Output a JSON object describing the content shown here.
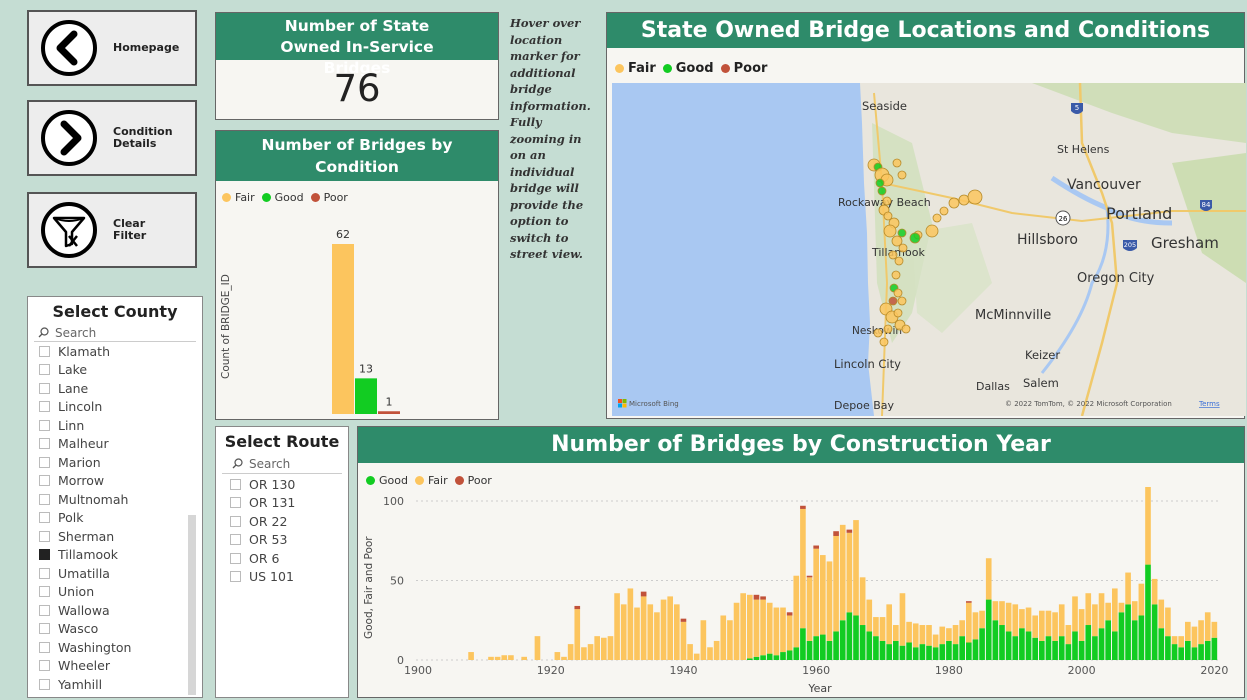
{
  "nav": {
    "home_label": "Homepage",
    "condition_label": "Condition\nDetails",
    "clear_label": "Clear\nFilter"
  },
  "kpi": {
    "title": "Number of State Owned In-Service Bridges",
    "value": "76"
  },
  "note": "Hover over location marker for additional bridge information. Fully zooming in on an individual bridge will provide the option to switch to street view.",
  "colors": {
    "fair": "#fcc55e",
    "good": "#12cc22",
    "poor": "#c1523a",
    "header": "#2e8b6a",
    "background": "#c5ddd3"
  },
  "condition_chart": {
    "title": "Number of Bridges by Condition",
    "legend": [
      "Fair",
      "Good",
      "Poor"
    ],
    "ylabel": "Count of BRIDGE_ID"
  },
  "county_slicer": {
    "title": "Select County",
    "search_placeholder": "Search",
    "items": [
      {
        "label": "Klamath",
        "checked": false
      },
      {
        "label": "Lake",
        "checked": false
      },
      {
        "label": "Lane",
        "checked": false
      },
      {
        "label": "Lincoln",
        "checked": false
      },
      {
        "label": "Linn",
        "checked": false
      },
      {
        "label": "Malheur",
        "checked": false
      },
      {
        "label": "Marion",
        "checked": false
      },
      {
        "label": "Morrow",
        "checked": false
      },
      {
        "label": "Multnomah",
        "checked": false
      },
      {
        "label": "Polk",
        "checked": false
      },
      {
        "label": "Sherman",
        "checked": false
      },
      {
        "label": "Tillamook",
        "checked": true
      },
      {
        "label": "Umatilla",
        "checked": false
      },
      {
        "label": "Union",
        "checked": false
      },
      {
        "label": "Wallowa",
        "checked": false
      },
      {
        "label": "Wasco",
        "checked": false
      },
      {
        "label": "Washington",
        "checked": false
      },
      {
        "label": "Wheeler",
        "checked": false
      },
      {
        "label": "Yamhill",
        "checked": false
      }
    ]
  },
  "route_slicer": {
    "title": "Select Route",
    "search_placeholder": "Search",
    "items": [
      "OR 130",
      "OR 131",
      "OR 22",
      "OR 53",
      "OR 6",
      "US 101"
    ]
  },
  "map": {
    "title": "State Owned Bridge Locations and Conditions",
    "legend": [
      "Fair",
      "Good",
      "Poor"
    ],
    "places": [
      "Seaside",
      "St Helens",
      "Vancouver",
      "Portland",
      "Rockaway Beach",
      "Hillsboro",
      "Gresham",
      "Tillamook",
      "Oregon City",
      "McMinnville",
      "Neskowin",
      "Lincoln City",
      "Keizer",
      "Salem",
      "Dallas",
      "Depoe Bay"
    ],
    "shields": [
      "5",
      "26",
      "84",
      "205"
    ],
    "bing": "Microsoft Bing",
    "copyright": "© 2022 TomTom, © 2022 Microsoft Corporation",
    "terms": "Terms"
  },
  "chart_data": [
    {
      "type": "bar",
      "title": "Number of Bridges by Condition",
      "categories": [
        "Fair",
        "Good",
        "Poor"
      ],
      "values": [
        62,
        13,
        1
      ],
      "ylabel": "Count of BRIDGE_ID",
      "ylim": [
        0,
        62
      ]
    },
    {
      "type": "bar",
      "title": "Number of Bridges by Construction Year",
      "xlabel": "Year",
      "ylabel": "Good, Fair and Poor",
      "legend": [
        "Good",
        "Fair",
        "Poor"
      ],
      "stacked": true,
      "xlim": [
        1900,
        2021
      ],
      "ylim": [
        0,
        100
      ],
      "yticks": [
        0,
        50,
        100
      ],
      "xticks": [
        1900,
        1920,
        1940,
        1960,
        1980,
        2000,
        2020
      ],
      "x": [
        1908,
        1911,
        1912,
        1913,
        1914,
        1916,
        1918,
        1921,
        1922,
        1923,
        1924,
        1925,
        1926,
        1927,
        1928,
        1929,
        1930,
        1931,
        1932,
        1933,
        1934,
        1935,
        1936,
        1937,
        1938,
        1939,
        1940,
        1941,
        1942,
        1943,
        1944,
        1945,
        1946,
        1947,
        1948,
        1949,
        1950,
        1951,
        1952,
        1953,
        1954,
        1955,
        1956,
        1957,
        1958,
        1959,
        1960,
        1961,
        1962,
        1963,
        1964,
        1965,
        1966,
        1967,
        1968,
        1969,
        1970,
        1971,
        1972,
        1973,
        1974,
        1975,
        1976,
        1977,
        1978,
        1979,
        1980,
        1981,
        1982,
        1983,
        1984,
        1985,
        1986,
        1987,
        1988,
        1989,
        1990,
        1991,
        1992,
        1993,
        1994,
        1995,
        1996,
        1997,
        1998,
        1999,
        2000,
        2001,
        2002,
        2003,
        2004,
        2005,
        2006,
        2007,
        2008,
        2009,
        2010,
        2011,
        2012,
        2013,
        2014,
        2015,
        2016,
        2017,
        2018,
        2019,
        2020
      ],
      "series": [
        {
          "name": "Good",
          "values": [
            0,
            0,
            0,
            0,
            0,
            0,
            0,
            0,
            0,
            0,
            0,
            0,
            0,
            0,
            0,
            0,
            0,
            0,
            0,
            0,
            0,
            0,
            0,
            0,
            0,
            0,
            0,
            0,
            0,
            0,
            0,
            0,
            0,
            0,
            0,
            0,
            1,
            2,
            3,
            4,
            3,
            5,
            6,
            8,
            20,
            12,
            15,
            16,
            12,
            18,
            25,
            30,
            28,
            22,
            18,
            15,
            12,
            10,
            12,
            9,
            11,
            8,
            10,
            9,
            8,
            10,
            12,
            10,
            15,
            11,
            13,
            20,
            38,
            25,
            22,
            18,
            15,
            20,
            18,
            14,
            12,
            15,
            12,
            15,
            10,
            18,
            12,
            22,
            15,
            20,
            25,
            18,
            30,
            35,
            25,
            28,
            60,
            35,
            20,
            15,
            10,
            8,
            12,
            8,
            10,
            12,
            14
          ],
          "poor_note": ""
        },
        {
          "name": "Fair",
          "values": [
            5,
            2,
            2,
            3,
            3,
            2,
            15,
            5,
            2,
            10,
            32,
            8,
            10,
            15,
            14,
            15,
            42,
            35,
            45,
            33,
            40,
            35,
            30,
            38,
            40,
            35,
            24,
            10,
            4,
            25,
            8,
            12,
            28,
            25,
            36,
            42,
            40,
            36,
            35,
            32,
            30,
            28,
            22,
            45,
            75,
            40,
            55,
            50,
            50,
            60,
            60,
            50,
            60,
            30,
            20,
            12,
            15,
            25,
            10,
            33,
            13,
            15,
            12,
            13,
            8,
            11,
            8,
            12,
            10,
            25,
            17,
            11,
            26,
            12,
            15,
            18,
            20,
            12,
            15,
            14,
            19,
            16,
            18,
            20,
            12,
            22,
            20,
            20,
            20,
            22,
            11,
            27,
            6,
            20,
            12,
            20,
            50,
            16,
            18,
            18,
            5,
            7,
            12,
            13,
            15,
            18,
            10
          ],
          "poor_note": ""
        },
        {
          "name": "Poor",
          "values": [
            0,
            0,
            0,
            0,
            0,
            0,
            0,
            0,
            0,
            0,
            2,
            0,
            0,
            0,
            0,
            0,
            0,
            0,
            0,
            0,
            3,
            0,
            0,
            0,
            0,
            0,
            2,
            0,
            0,
            0,
            0,
            0,
            0,
            0,
            0,
            0,
            0,
            3,
            2,
            0,
            0,
            0,
            2,
            0,
            2,
            1,
            2,
            0,
            0,
            3,
            0,
            2,
            0,
            0,
            0,
            0,
            0,
            0,
            0,
            0,
            0,
            0,
            0,
            0,
            0,
            0,
            0,
            0,
            0,
            1,
            0,
            0,
            0,
            0,
            0,
            0,
            0,
            0,
            0,
            0,
            0,
            0,
            0,
            0,
            0,
            0,
            0,
            0,
            0,
            0,
            0,
            0,
            0,
            0,
            0,
            0,
            0,
            0,
            0,
            0,
            0,
            0,
            0,
            0,
            0,
            0,
            0
          ]
        }
      ]
    }
  ],
  "year_chart": {
    "title": "Number of Bridges by Construction Year",
    "legend": [
      "Good",
      "Fair",
      "Poor"
    ],
    "xlabel": "Year",
    "ylabel": "Good, Fair and Poor"
  }
}
